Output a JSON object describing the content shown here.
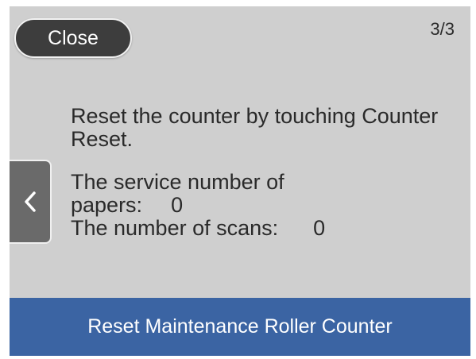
{
  "header": {
    "close_label": "Close",
    "page_indicator": "3/3"
  },
  "nav": {
    "back_icon": "chevron-left-icon"
  },
  "content": {
    "instruction": "Reset the counter by touching Counter Reset.",
    "papers_label_line1": "The service number of",
    "papers_label_line2": "papers:",
    "papers_value": "0",
    "scans_label": "The number of scans:",
    "scans_value": "0"
  },
  "footer": {
    "title": "Reset Maintenance Roller Counter"
  },
  "colors": {
    "screen_bg": "#cfcfcf",
    "close_button": "#3d3d3d",
    "back_button": "#6a6a6a",
    "footer_bar": "#3b64a3"
  }
}
